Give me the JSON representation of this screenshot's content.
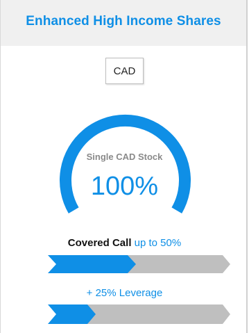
{
  "header": {
    "title": "Enhanced High Income Shares"
  },
  "currency": {
    "label": "CAD"
  },
  "gauge": {
    "label": "Single CAD Stock",
    "value_text": "100%",
    "fill_fraction": 1.0
  },
  "covered_call": {
    "label_bold": "Covered  Call",
    "label_accent": "up to 50%",
    "fill_fraction": 0.5
  },
  "leverage": {
    "label": "+ 25% Leverage",
    "fill_fraction": 0.25
  },
  "colors": {
    "accent": "#0f8fe6",
    "header_bg": "#f0f0f0",
    "inactive": "#bfbfbf",
    "muted_text": "#8a8a8a"
  }
}
